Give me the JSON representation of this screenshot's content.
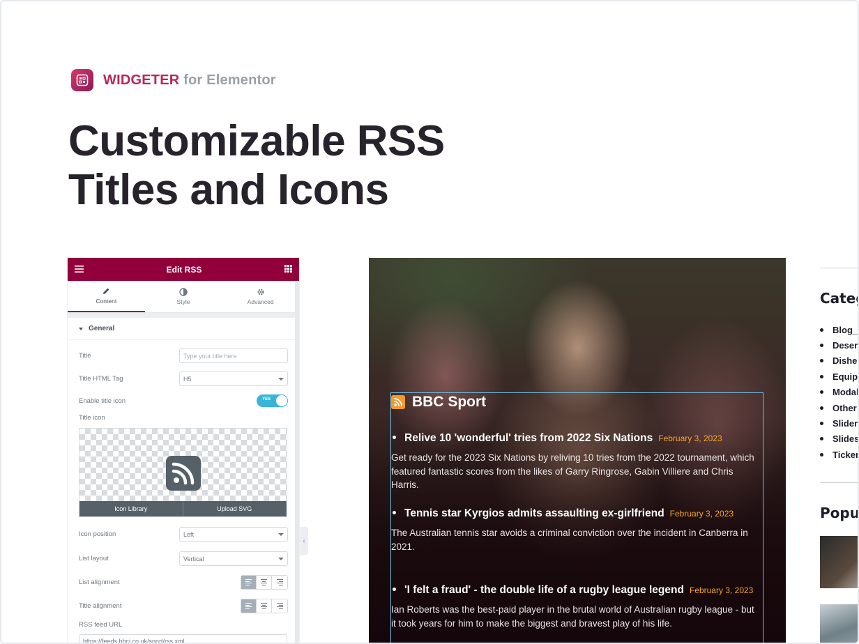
{
  "brand": {
    "name": "WIDGETER",
    "suffix": "for Elementor"
  },
  "headline": {
    "line1": "Customizable RSS",
    "line2": "Titles and Icons"
  },
  "editor": {
    "title": "Edit RSS",
    "tabs": [
      {
        "label": "Content",
        "icon": "pencil-icon"
      },
      {
        "label": "Style",
        "icon": "half-circle-icon"
      },
      {
        "label": "Advanced",
        "icon": "gear-icon"
      }
    ],
    "section": "General",
    "fields": {
      "title_label": "Title",
      "title_placeholder": "Type your title here",
      "tag_label": "Title HTML Tag",
      "tag_value": "H5",
      "enable_icon_label": "Enable title icon",
      "toggle_text": "YES",
      "title_icon_label": "Title icon",
      "icon_library": "Icon Library",
      "upload_svg": "Upload SVG",
      "icon_position_label": "Icon position",
      "icon_position_value": "Left",
      "list_layout_label": "List layout",
      "list_layout_value": "Vertical",
      "list_alignment_label": "List alignment",
      "title_alignment_label": "Title alignment",
      "rss_url_label": "RSS feed URL",
      "rss_url_value": "https://feeds.bbci.co.uk/sport/rss.xml"
    }
  },
  "preview": {
    "feed_title": "BBC Sport",
    "items": [
      {
        "title": "Relive 10 'wonderful' tries from 2022 Six Nations",
        "date": "February 3, 2023",
        "desc": "Get ready for the 2023 Six Nations by reliving 10 tries from the 2022 tournament, which featured fantastic scores from the likes of Garry Ringrose, Gabin Villiere and Chris Harris."
      },
      {
        "title": "Tennis star Kyrgios admits assaulting ex-girlfriend",
        "date": "February 3, 2023",
        "desc": "The Australian tennis star avoids a criminal conviction over the incident in Canberra in 2021."
      },
      {
        "title": "'I felt a fraud' - the double life of a rugby league legend",
        "date": "February 3, 2023",
        "desc": "Ian Roberts was the best-paid player in the brutal world of Australian rugby league - but it took years for him to make the biggest and bravest play of his life."
      }
    ]
  },
  "sidebar": {
    "categories_heading": "Categ",
    "categories": [
      "Blog_v",
      "Deser",
      "Dishes",
      "Equipr",
      "Modal",
      "Other",
      "Slider",
      "Slides",
      "Ticker"
    ],
    "popular_heading": "Popu"
  },
  "colors": {
    "brand": "#b8265c",
    "editor_header": "#92003b",
    "date": "#f5a623",
    "rss_icon": "#f29a2e"
  }
}
